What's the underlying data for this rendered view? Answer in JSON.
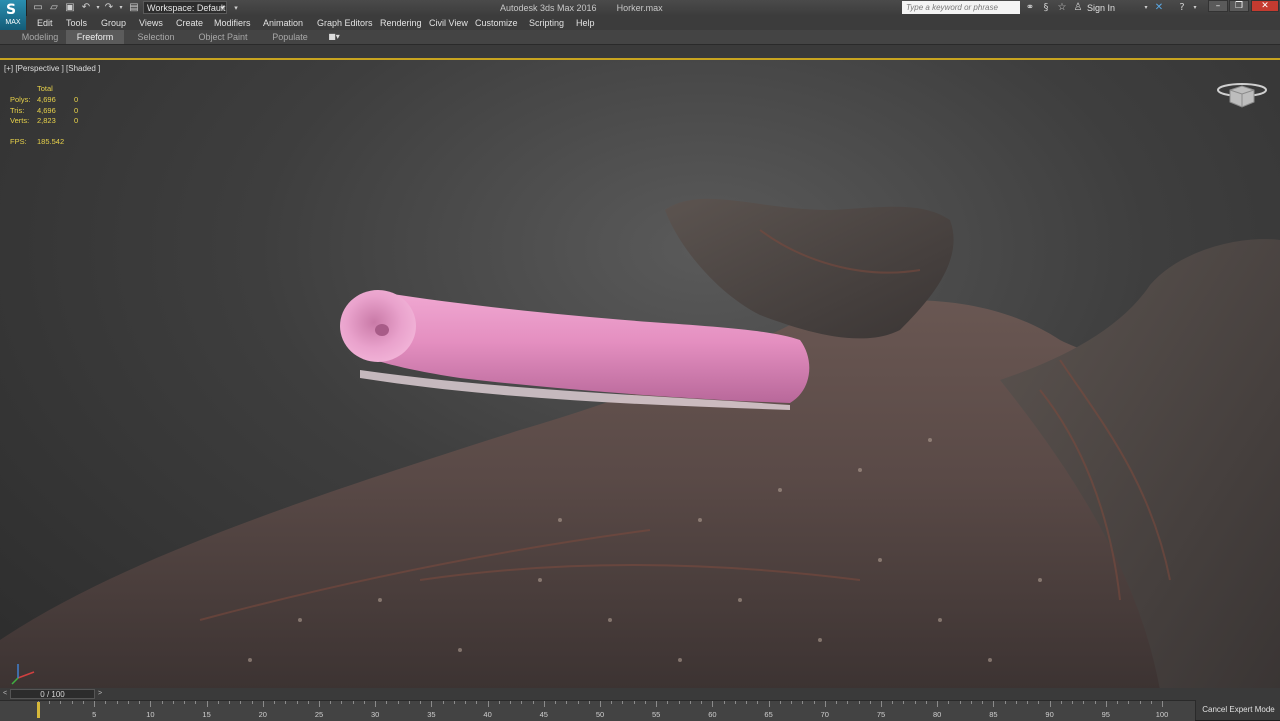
{
  "titlebar": {
    "app_logo_letter": "S",
    "app_logo_label": "MAX",
    "workspace": "Workspace: Default",
    "app_name": "Autodesk 3ds Max 2016",
    "file_name": "Horker.max",
    "search_placeholder": "Type a keyword or phrase",
    "sign_in": "Sign In"
  },
  "menu": [
    "Edit",
    "Tools",
    "Group",
    "Views",
    "Create",
    "Modifiers",
    "Animation",
    "Graph Editors",
    "Rendering",
    "Civil View",
    "Customize",
    "Scripting",
    "Help"
  ],
  "ribbon": {
    "tabs": [
      "Modeling",
      "Freeform",
      "Selection",
      "Object Paint",
      "Populate"
    ],
    "active_tab": "Freeform"
  },
  "viewport": {
    "label": "[+] [Perspective ] [Shaded ]",
    "stats": {
      "header": "Total",
      "rows": [
        {
          "label": "Polys:",
          "value": "4,696",
          "sel": "0"
        },
        {
          "label": "Tris:",
          "value": "4,696",
          "sel": "0"
        },
        {
          "label": "Verts:",
          "value": "2,823",
          "sel": "0"
        }
      ],
      "fps_label": "FPS:",
      "fps_value": "185.542"
    }
  },
  "timeline": {
    "slider": "0 / 100",
    "prev": "<",
    "next": ">",
    "ticks": [
      "5",
      "10",
      "15",
      "20",
      "25",
      "30",
      "35",
      "40",
      "45",
      "50",
      "55",
      "60",
      "65",
      "70",
      "75",
      "80",
      "85",
      "90",
      "95",
      "100"
    ]
  },
  "status": {
    "cancel_expert_mode": "Cancel Expert Mode"
  },
  "colors": {
    "viewport_border": "#c8a420",
    "stat_text": "#e8d24a",
    "accent_blue": "#2a8fb0",
    "tube_pink": "#e48fc0"
  }
}
